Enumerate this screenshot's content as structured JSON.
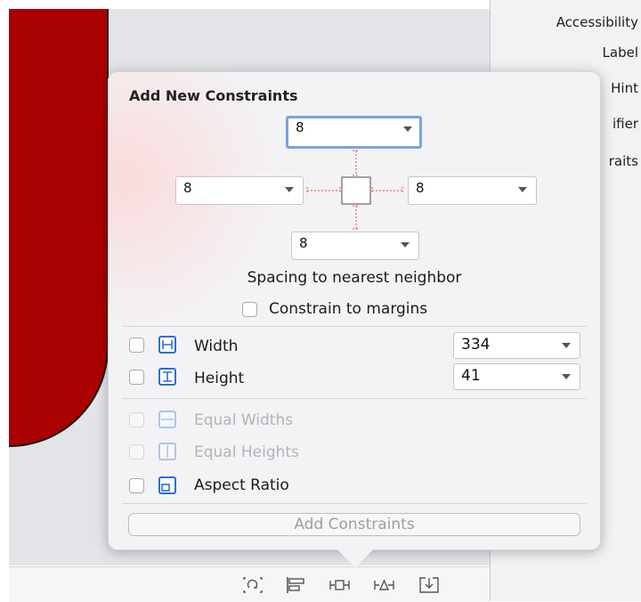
{
  "inspector": {
    "items": [
      "Accessibility",
      "Label",
      "Hint",
      "ifier",
      "raits"
    ]
  },
  "popover": {
    "title": "Add New Constraints",
    "spacing": {
      "top": "8",
      "left": "8",
      "right": "8",
      "bottom": "8"
    },
    "spacing_caption": "Spacing to nearest neighbor",
    "constrain_margins_label": "Constrain to margins",
    "width_label": "Width",
    "width_value": "334",
    "height_label": "Height",
    "height_value": "41",
    "equal_widths_label": "Equal Widths",
    "equal_heights_label": "Equal Heights",
    "aspect_ratio_label": "Aspect Ratio",
    "add_button_label": "Add Constraints"
  },
  "colors": {
    "accent": "#2c6fd4",
    "view_fill": "#aa0101",
    "focus_ring": "#7aa3e0",
    "strut": "#e56a6a"
  },
  "toolbar": {
    "icons": [
      "update-frames-icon",
      "align-icon",
      "add-constraints-icon",
      "resolve-issues-icon",
      "embed-in-icon"
    ]
  }
}
